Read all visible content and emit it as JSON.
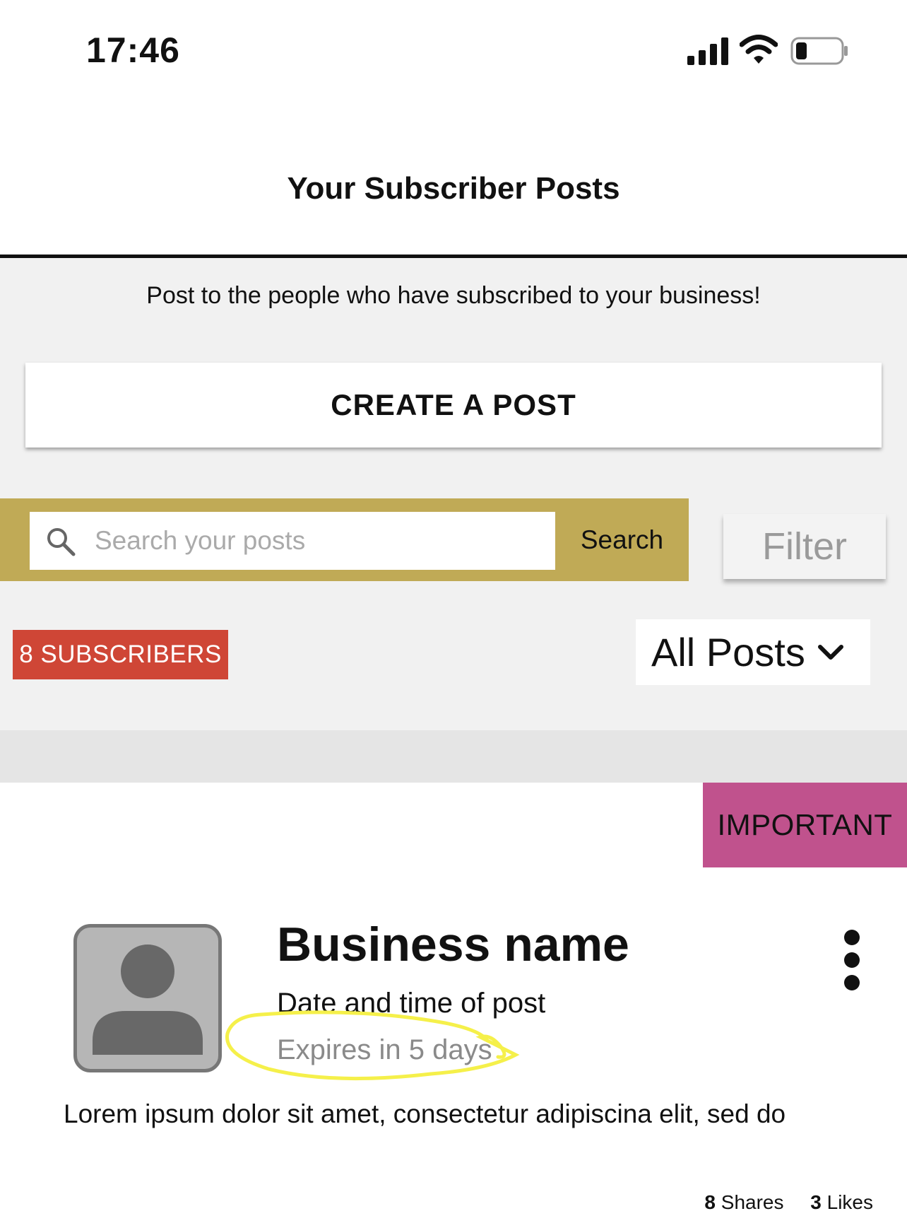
{
  "status_bar": {
    "time": "17:46",
    "icons": [
      "signal-icon",
      "wifi-icon",
      "battery-icon"
    ]
  },
  "header": {
    "title": "Your Subscriber Posts"
  },
  "intro": {
    "text": "Post to the people who have subscribed to your business!",
    "create_button_label": "CREATE A POST"
  },
  "search": {
    "placeholder": "Search your posts",
    "value": "",
    "button_label": "Search",
    "filter_label": "Filter",
    "bar_color": "#c0aa56"
  },
  "subscribers": {
    "label": "8 SUBSCRIBERS",
    "color": "#cf4636"
  },
  "posts_filter": {
    "selected": "All Posts"
  },
  "post": {
    "tag": "IMPORTANT",
    "tag_color": "#c0528d",
    "business_name": "Business name",
    "date_text": "Date and time of post",
    "expiry_text": "Expires in 5 days",
    "body": "Lorem ipsum dolor sit amet, consectetur adipiscina elit, sed do",
    "shares_count": "8",
    "shares_label": "Shares",
    "likes_count": "3",
    "likes_label": "Likes",
    "highlight_color": "#f5f04a"
  }
}
